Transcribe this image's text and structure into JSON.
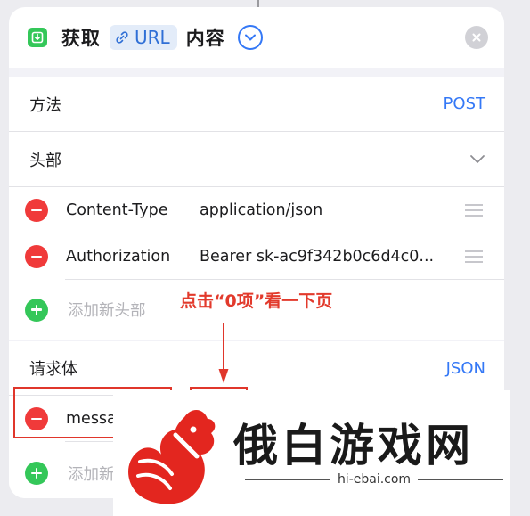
{
  "header": {
    "title_prefix": "获取",
    "chip_label": "URL",
    "title_suffix": "内容"
  },
  "method": {
    "label": "方法",
    "value": "POST"
  },
  "headers_section": {
    "label": "头部",
    "items": [
      {
        "key": "Content-Type",
        "value": "application/json"
      },
      {
        "key": "Authorization",
        "value": "Bearer sk-ac9f342b0c6d4c0..."
      }
    ],
    "add_label": "添加新头部"
  },
  "body_section": {
    "label": "请求体",
    "value": "JSON",
    "items": [
      {
        "key": "messa"
      }
    ],
    "add_label": "添加新"
  },
  "annotation": {
    "text": "点击“0项”看一下页"
  },
  "watermark": {
    "title": "俄白游戏网",
    "url": "hi-ebai.com"
  },
  "colors": {
    "accent": "#3478f6",
    "remove": "#f03a3a",
    "add": "#34c759",
    "annotation": "#e23a2c"
  }
}
